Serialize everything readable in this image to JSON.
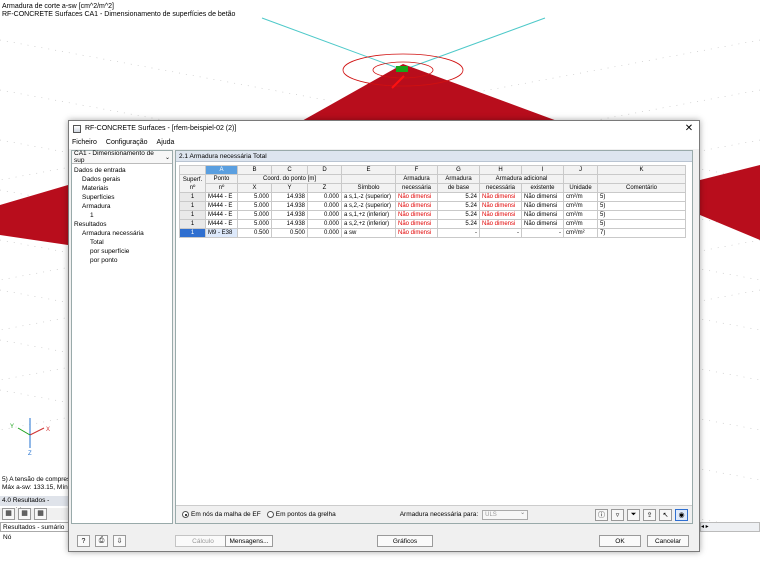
{
  "background": {
    "title_line1": "Armadura de corte a-sw [cm^2/m^2]",
    "title_line2": "RF-CONCRETE Surfaces CA1 - Dimensionamento de superfícies de betão",
    "note_line1": "5) A tensão de compres",
    "note_line2": "Máx a-sw: 133.15, Mín a",
    "results_label": "4.0 Resultados - sumári",
    "results_tab": "Resultados - sumário",
    "results_tab2": "Nó",
    "axis_y": "Y",
    "axis_x": "X",
    "axis_z": "Z",
    "surface_color": "#b80d1c"
  },
  "dialog": {
    "title": "RF-CONCRETE Surfaces - [rfem-beispiel-02 (2)]",
    "close_symbol": "✕",
    "menu": [
      "Ficheiro",
      "Configuração",
      "Ajuda"
    ],
    "case_select": "CA1 - Dimensionamento de sup",
    "tree": {
      "input": "Dados de entrada",
      "general": "Dados gerais",
      "materials": "Materiais",
      "surfaces": "Superfícies",
      "reinforcement": "Armadura",
      "reinf_1": "1",
      "results": "Resultados",
      "required": "Armadura necessária",
      "total": "Total",
      "by_surface": "por superfície",
      "by_point": "por ponto"
    },
    "section_title": "2.1 Armadura necessária Total",
    "table": {
      "letters": [
        "A",
        "B",
        "C",
        "D",
        "E",
        "F",
        "G",
        "H",
        "I",
        "J",
        "K"
      ],
      "h_surface": "Superf.",
      "h_surface_no": "nº",
      "h_point": "Ponto",
      "h_point_no": "nº",
      "h_coord": "Coord. do ponto [m]",
      "h_x": "X",
      "h_y": "Y",
      "h_z": "Z",
      "h_symbol": "Símbolo",
      "h_req1": "Armadura",
      "h_req2": "necessária",
      "h_base1": "Armadura",
      "h_base2": "de base",
      "h_add": "Armadura adicional",
      "h_add_req": "necessária",
      "h_add_exist": "existente",
      "h_unit": "Unidade",
      "h_comment": "Comentário",
      "rows": [
        {
          "surf": "1",
          "point": "M444 - E",
          "x": "5.000",
          "y": "14.938",
          "z": "0.000",
          "symbol": "a s,1,-z (superior)",
          "req": "Não dimensi",
          "base": "5.24",
          "add_req": "Não dimensi",
          "add_exist": "Não dimensi",
          "unit": "cm²/m",
          "comment": "5)"
        },
        {
          "surf": "1",
          "point": "M444 - E",
          "x": "5.000",
          "y": "14.938",
          "z": "0.000",
          "symbol": "a s,2,-z (superior)",
          "req": "Não dimensi",
          "base": "5.24",
          "add_req": "Não dimensi",
          "add_exist": "Não dimensi",
          "unit": "cm²/m",
          "comment": "5)"
        },
        {
          "surf": "1",
          "point": "M444 - E",
          "x": "5.000",
          "y": "14.938",
          "z": "0.000",
          "symbol": "a s,1,+z (inferior)",
          "req": "Não dimensi",
          "base": "5.24",
          "add_req": "Não dimensi",
          "add_exist": "Não dimensi",
          "unit": "cm²/m",
          "comment": "5)"
        },
        {
          "surf": "1",
          "point": "M444 - E",
          "x": "5.000",
          "y": "14.938",
          "z": "0.000",
          "symbol": "a s,2,+z (inferior)",
          "req": "Não dimensi",
          "base": "5.24",
          "add_req": "Não dimensi",
          "add_exist": "Não dimensi",
          "unit": "cm²/m",
          "comment": "5)"
        },
        {
          "surf": "1",
          "point": "M9 - E38",
          "x": "0.500",
          "y": "0.500",
          "z": "0.000",
          "symbol": "a sw",
          "req": "Não dimensi",
          "base": "-",
          "add_req": "-",
          "add_exist": "-",
          "unit": "cm²/m²",
          "comment": "7)"
        }
      ]
    },
    "options": {
      "radio1": "Em nós da malha de EF",
      "radio2": "Em pontos da grelha",
      "required_for": "Armadura necessária para:",
      "required_for_value": "ULS"
    },
    "buttons": {
      "calc": "Cálculo",
      "messages": "Mensagens...",
      "graphics": "Gráficos",
      "ok": "OK",
      "cancel": "Cancelar"
    }
  }
}
